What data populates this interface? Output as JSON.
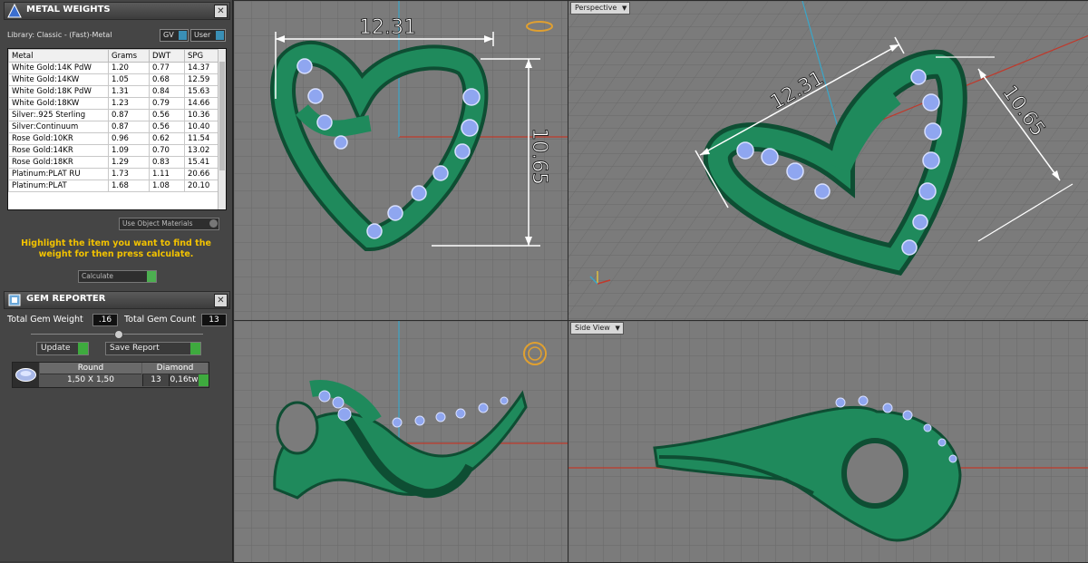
{
  "metal_weights": {
    "title": "METAL WEIGHTS",
    "library_label": "Library: Classic - (Fast)-Metal",
    "gv_label": "GV",
    "user_label": "User",
    "columns": [
      "Metal",
      "Grams",
      "DWT",
      "SPG"
    ],
    "rows": [
      [
        "White Gold:14K PdW",
        "1.20",
        "0.77",
        "14.37"
      ],
      [
        "White Gold:14KW",
        "1.05",
        "0.68",
        "12.59"
      ],
      [
        "White Gold:18K PdW",
        "1.31",
        "0.84",
        "15.63"
      ],
      [
        "White Gold:18KW",
        "1.23",
        "0.79",
        "14.66"
      ],
      [
        "Silver:.925 Sterling",
        "0.87",
        "0.56",
        "10.36"
      ],
      [
        "Silver:Continuum",
        "0.87",
        "0.56",
        "10.40"
      ],
      [
        "Rose Gold:10KR",
        "0.96",
        "0.62",
        "11.54"
      ],
      [
        "Rose Gold:14KR",
        "1.09",
        "0.70",
        "13.02"
      ],
      [
        "Rose Gold:18KR",
        "1.29",
        "0.83",
        "15.41"
      ],
      [
        "Platinum:PLAT RU",
        "1.73",
        "1.11",
        "20.66"
      ],
      [
        "Platinum:PLAT",
        "1.68",
        "1.08",
        "20.10"
      ]
    ],
    "use_object_materials": "Use Object Materials",
    "instruction": "Highlight the item you want to find the weight for then press calculate.",
    "calculate_label": "Calculate"
  },
  "gem_reporter": {
    "title": "GEM REPORTER",
    "total_weight_label": "Total Gem Weight",
    "total_weight_value": ".16",
    "total_count_label": "Total Gem Count",
    "total_count_value": "13",
    "update_label": "Update",
    "save_report_label": "Save Report",
    "gem_row": {
      "cut": "Round",
      "material": "Diamond",
      "size": "1,50 X 1,50",
      "count": "13",
      "weight": "0,16tw"
    }
  },
  "viewports": {
    "top": {
      "width_dim": "12.31",
      "height_dim": "10.65"
    },
    "perspective": {
      "label": "Perspective",
      "width_dim": "12.31",
      "height_dim": "10.65"
    },
    "front": {
      "label": ""
    },
    "side": {
      "label": "Side View"
    }
  },
  "colors": {
    "metal": "#1f8a5c",
    "metal_dark": "#0e4e33",
    "gem": "#8fa6f0",
    "grid": "#6d6d6d",
    "accent_green": "#3eaa3e",
    "axis_red": "#c0392b",
    "axis_blue": "#3aa6c8"
  }
}
